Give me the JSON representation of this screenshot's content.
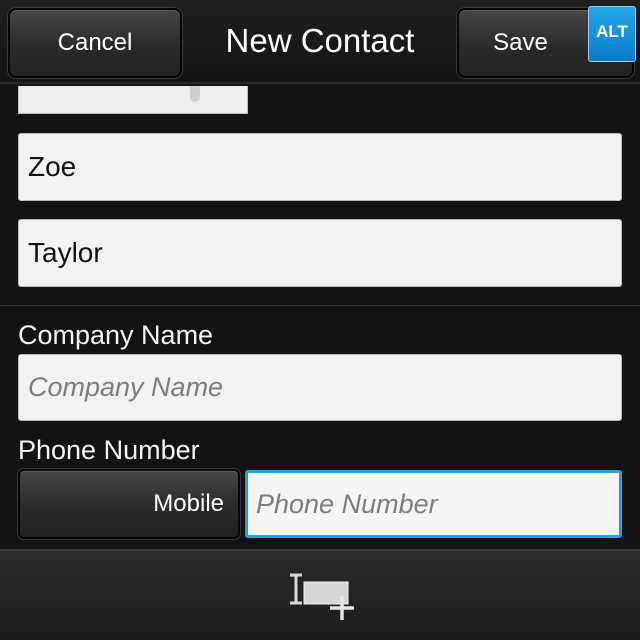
{
  "titlebar": {
    "cancel_label": "Cancel",
    "title": "New Contact",
    "save_label": "Save",
    "alt_badge": "ALT"
  },
  "fields": {
    "first_name_value": "Zoe",
    "last_name_value": "Taylor",
    "company": {
      "label": "Company Name",
      "placeholder": "Company Name",
      "value": ""
    },
    "phone": {
      "label": "Phone Number",
      "type": "Mobile",
      "placeholder": "Phone Number",
      "value": "",
      "focused": true
    }
  },
  "bottom_bar": {
    "add_field_icon": "add-field-icon"
  },
  "colors": {
    "focus_accent": "#1aa3e3",
    "alt_badge": "#1887d0"
  }
}
